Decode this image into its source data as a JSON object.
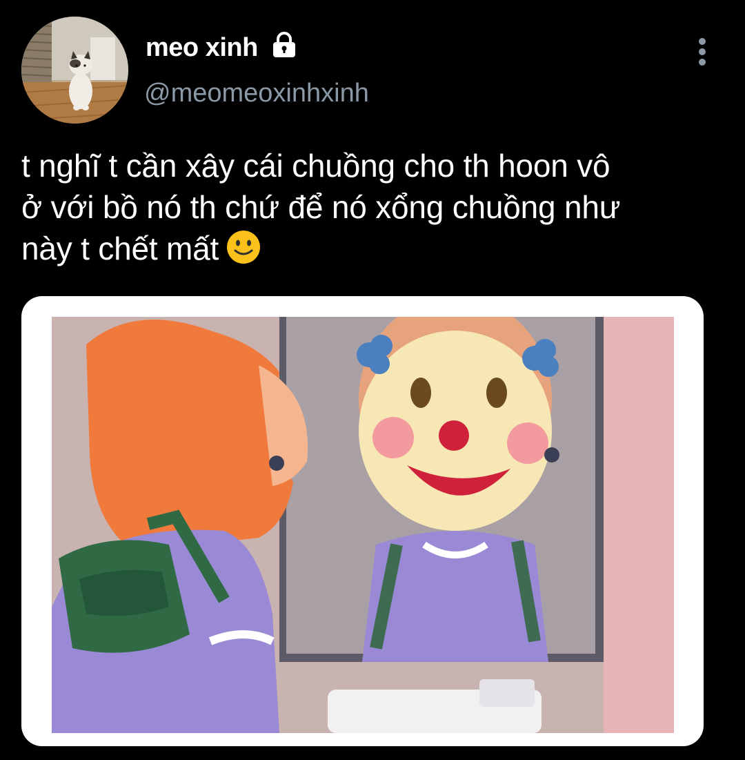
{
  "author": {
    "display_name": "meo xinh",
    "handle": "@meomeoxinhxinh",
    "avatar_icon": "cat-photo-avatar",
    "protected_icon": "lock-icon"
  },
  "menu": {
    "icon": "more-vertical-icon"
  },
  "tweet": {
    "text_line_1": "t nghĩ t cần xây cái chuồng cho th hoon vô",
    "text_line_2": "ở với bồ nó th chứ để nó xổng chuồng như",
    "text_line_3": "này t chết mất",
    "emoji": "slightly-smiling-face-icon"
  },
  "media": {
    "type": "image",
    "subject": "cartoon-girl-clown-mirror-meme"
  },
  "colors": {
    "background": "#000000",
    "text": "#ffffff",
    "secondary_text": "#8b98a5",
    "card_border": "#ffffff"
  }
}
